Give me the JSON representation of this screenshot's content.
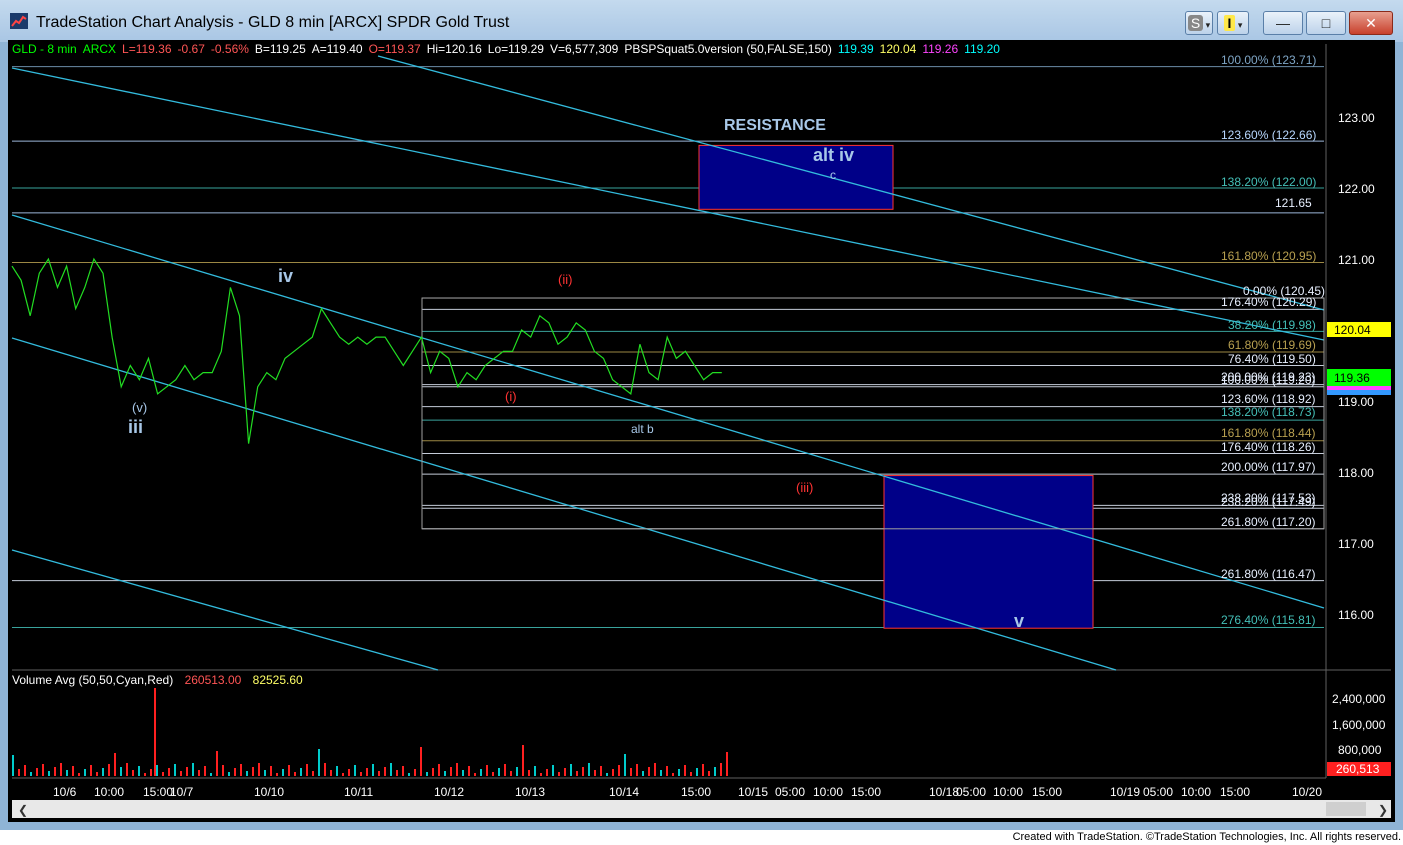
{
  "window": {
    "title": "TradeStation Chart Analysis - GLD 8 min [ARCX] SPDR Gold Trust",
    "buttons": {
      "s_label": "S",
      "i_label": "I",
      "minimize": "—",
      "maximize": "□",
      "close": "✕"
    }
  },
  "status_bar": [
    {
      "text": "GLD - 8 min",
      "color": "#00ff00"
    },
    {
      "text": "ARCX",
      "color": "#00ff00"
    },
    {
      "text": "L=119.36",
      "color": "#ff5555"
    },
    {
      "text": "-0.67",
      "color": "#ff5555"
    },
    {
      "text": "-0.56%",
      "color": "#ff5555"
    },
    {
      "text": "B=119.25",
      "color": "#ffffff"
    },
    {
      "text": "A=119.40",
      "color": "#ffffff"
    },
    {
      "text": "O=119.37",
      "color": "#ff5555"
    },
    {
      "text": "Hi=120.16",
      "color": "#ffffff"
    },
    {
      "text": "Lo=119.29",
      "color": "#ffffff"
    },
    {
      "text": "V=6,577,309",
      "color": "#ffffff"
    },
    {
      "text": "PBSPSquat5.0version (50,FALSE,150)",
      "color": "#ffffff"
    },
    {
      "text": "119.39",
      "color": "#00ffff"
    },
    {
      "text": "120.04",
      "color": "#ffff66"
    },
    {
      "text": "119.26",
      "color": "#ff44ff"
    },
    {
      "text": "119.20",
      "color": "#00ffff"
    }
  ],
  "volume_label": {
    "name": "Volume Avg (50,50,Cyan,Red)",
    "v1": "260513.00",
    "v2": "82525.60"
  },
  "price_axis": [
    "123.00",
    "122.00",
    "121.00",
    "119.00",
    "118.00",
    "117.00",
    "116.00"
  ],
  "price_markers": {
    "yellow": "120.04",
    "green": "119.36"
  },
  "volume_axis": [
    "2,400,000",
    "1,600,000",
    "800,000"
  ],
  "volume_marker": "260,513",
  "time_axis": [
    "10/6",
    "10:00",
    "15:00",
    "10/7",
    "10/10",
    "10/11",
    "10/12",
    "10/13",
    "10/14",
    "15:00",
    "10/15",
    "05:00",
    "10:00",
    "15:00",
    "10/18",
    "05:00",
    "10:00",
    "15:00",
    "10/19",
    "05:00",
    "10:00",
    "15:00",
    "10/20"
  ],
  "fib_labels": [
    {
      "text": "100.00% (123.71)",
      "color": "#7fa6c6"
    },
    {
      "text": "123.60% (122.66)",
      "color": "#b8d8ff"
    },
    {
      "text": "138.20% (122.00)",
      "color": "#44c0b8"
    },
    {
      "text": "121.65",
      "color": "#e8f0ff"
    },
    {
      "text": "161.80% (120.95)",
      "color": "#b8a050"
    },
    {
      "text": "0.00% (120.45)",
      "color": "#e8f0ff"
    },
    {
      "text": "176.40% (120.29)",
      "color": "#e8f0ff"
    },
    {
      "text": "38.20% (119.98)",
      "color": "#44c0b8"
    },
    {
      "text": "61.80% (119.69)",
      "color": "#b8a050"
    },
    {
      "text": "76.40% (119.50)",
      "color": "#e8f0ff"
    },
    {
      "text": "200.00% (119.23)",
      "color": "#e8f0ff"
    },
    {
      "text": "100.00% (119.20)",
      "color": "#e8f0ff"
    },
    {
      "text": "123.60% (118.92)",
      "color": "#e8f0ff"
    },
    {
      "text": "138.20% (118.73)",
      "color": "#44c0b8"
    },
    {
      "text": "161.80% (118.44)",
      "color": "#b8a050"
    },
    {
      "text": "176.40% (118.26)",
      "color": "#e8f0ff"
    },
    {
      "text": "200.00% (117.97)",
      "color": "#e8f0ff"
    },
    {
      "text": "238.20% (117.53)",
      "color": "#e8f0ff"
    },
    {
      "text": "238.20% (117.49)",
      "color": "#e8f0ff"
    },
    {
      "text": "261.80% (117.20)",
      "color": "#e8f0ff"
    },
    {
      "text": "261.80% (116.47)",
      "color": "#e8f0ff"
    },
    {
      "text": "276.40% (115.81)",
      "color": "#44c0b8"
    }
  ],
  "annotations": [
    {
      "text": "RESISTANCE",
      "color": "#a8c8e8"
    },
    {
      "text": "alt iv",
      "color": "#a8c8e8"
    },
    {
      "text": "c",
      "color": "#a8c8e8"
    },
    {
      "text": "iv",
      "color": "#a8c8e8"
    },
    {
      "text": "(ii)",
      "color": "#ff3333"
    },
    {
      "text": "(i)",
      "color": "#ff3333"
    },
    {
      "text": "(v)",
      "color": "#a8c8e8"
    },
    {
      "text": "iii",
      "color": "#a8c8e8"
    },
    {
      "text": "alt b",
      "color": "#a8c8e8"
    },
    {
      "text": "(iii)",
      "color": "#ff3333"
    },
    {
      "text": "v",
      "color": "#a8c8e8"
    }
  ],
  "footer": {
    "text": "Created with TradeStation. ©TradeStation Technologies, Inc. All rights reserved."
  },
  "chart_data": {
    "type": "line",
    "title": "GLD 8 min [ARCX] SPDR Gold Trust",
    "ylim": [
      115.3,
      123.8
    ],
    "price_path": [
      [
        0,
        120.9
      ],
      [
        1,
        120.7
      ],
      [
        2,
        120.2
      ],
      [
        3,
        120.8
      ],
      [
        4,
        121.0
      ],
      [
        5,
        120.6
      ],
      [
        6,
        120.9
      ],
      [
        7,
        120.3
      ],
      [
        8,
        120.6
      ],
      [
        9,
        121.0
      ],
      [
        10,
        120.8
      ],
      [
        11,
        119.9
      ],
      [
        12,
        119.2
      ],
      [
        13,
        119.5
      ],
      [
        14,
        119.3
      ],
      [
        15,
        119.6
      ],
      [
        16,
        119.1
      ],
      [
        17,
        119.2
      ],
      [
        18,
        119.3
      ],
      [
        19,
        119.5
      ],
      [
        20,
        119.3
      ],
      [
        21,
        119.4
      ],
      [
        22,
        119.4
      ],
      [
        23,
        119.7
      ],
      [
        24,
        120.6
      ],
      [
        25,
        120.2
      ],
      [
        26,
        118.4
      ],
      [
        27,
        119.2
      ],
      [
        28,
        119.4
      ],
      [
        29,
        119.3
      ],
      [
        30,
        119.6
      ],
      [
        31,
        119.7
      ],
      [
        32,
        119.8
      ],
      [
        33,
        119.9
      ],
      [
        34,
        120.3
      ],
      [
        35,
        120.1
      ],
      [
        36,
        119.9
      ],
      [
        37,
        119.8
      ],
      [
        38,
        119.9
      ],
      [
        39,
        119.8
      ],
      [
        40,
        119.9
      ],
      [
        41,
        119.9
      ],
      [
        42,
        119.7
      ],
      [
        43,
        119.5
      ],
      [
        44,
        119.7
      ],
      [
        45,
        119.9
      ],
      [
        46,
        119.4
      ],
      [
        47,
        119.7
      ],
      [
        48,
        119.6
      ],
      [
        49,
        119.2
      ],
      [
        50,
        119.4
      ],
      [
        51,
        119.3
      ],
      [
        52,
        119.5
      ],
      [
        53,
        119.6
      ],
      [
        54,
        119.7
      ],
      [
        55,
        119.7
      ],
      [
        56,
        120.0
      ],
      [
        57,
        119.9
      ],
      [
        58,
        120.2
      ],
      [
        59,
        120.1
      ],
      [
        60,
        119.8
      ],
      [
        61,
        119.9
      ],
      [
        62,
        120.1
      ],
      [
        63,
        120.0
      ],
      [
        64,
        119.7
      ],
      [
        65,
        119.6
      ],
      [
        66,
        119.3
      ],
      [
        67,
        119.2
      ],
      [
        68,
        119.1
      ],
      [
        69,
        119.8
      ],
      [
        70,
        119.4
      ],
      [
        71,
        119.3
      ],
      [
        72,
        119.9
      ],
      [
        73,
        119.6
      ],
      [
        74,
        119.7
      ],
      [
        75,
        119.5
      ],
      [
        76,
        119.3
      ],
      [
        77,
        119.4
      ],
      [
        78,
        119.4
      ]
    ],
    "fib_levels": [
      123.71,
      122.66,
      122.0,
      121.65,
      120.95,
      120.45,
      120.29,
      119.98,
      119.69,
      119.5,
      119.23,
      119.2,
      118.92,
      118.73,
      118.44,
      118.26,
      117.97,
      117.53,
      117.49,
      117.2,
      116.47,
      115.81
    ],
    "zones": [
      {
        "name": "RESISTANCE",
        "from": 121.7,
        "to": 122.6
      },
      {
        "name": "v",
        "from": 115.8,
        "to": 117.95
      }
    ]
  }
}
